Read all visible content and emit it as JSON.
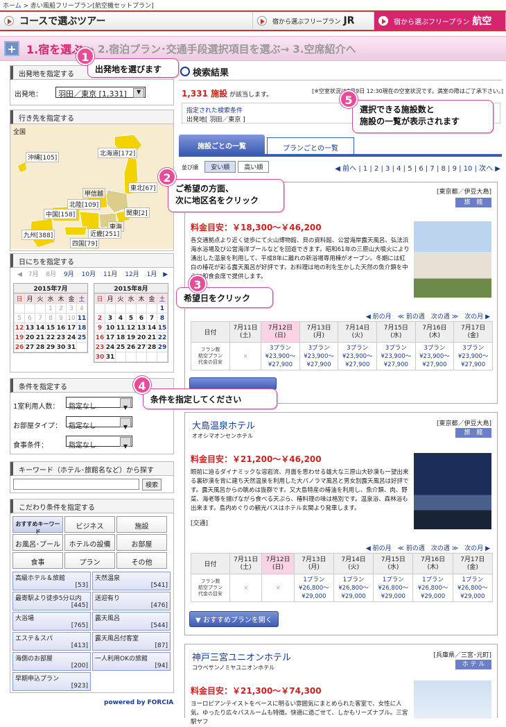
{
  "breadcrumb": {
    "home": "ホーム",
    "sep": ">",
    "current": "赤い風船フリープラン[航空機セットプラン]"
  },
  "nav": {
    "tour": "コースで選ぶツアー",
    "jr_small": "宿から選ぶフリープラン",
    "jr": "JR",
    "air_small": "宿から選ぶフリープラン",
    "air": "航空"
  },
  "steps": {
    "s1": "1.宿を選ぶ",
    "s2": "→ 2.宿泊プラン･交通手段選択項目を選ぶ→ 3.空席紹介へ"
  },
  "departure": {
    "header": "出発地を指定する",
    "label": "出発地：",
    "value": "羽田／東京 [1,331]"
  },
  "destination": {
    "header": "行き先を指定する",
    "all": "全国",
    "regions": [
      "沖縄[105]",
      "北海道[172]",
      "東北[67]",
      "甲信越",
      "北陸[109]",
      "関東[2]",
      "中国[158]",
      "東海",
      "九州[388]",
      "近畿[251]",
      "四国[79]"
    ]
  },
  "calendar": {
    "header": "日にちを指定する",
    "prev": "◀",
    "months": [
      "7月",
      "8月",
      "9月",
      "10月",
      "11月",
      "12月",
      "1月"
    ],
    "next": "▶",
    "m1": {
      "title": "2015年7月",
      "rows": [
        [
          "",
          "",
          "",
          "1",
          "2",
          "3",
          "4"
        ],
        [
          "5",
          "6",
          "7",
          "8",
          "9",
          "10",
          "11"
        ],
        [
          "12",
          "13",
          "14",
          "15",
          "16",
          "17",
          "18"
        ],
        [
          "19",
          "20",
          "21",
          "22",
          "23",
          "24",
          "25"
        ],
        [
          "26",
          "27",
          "28",
          "29",
          "30",
          "31",
          ""
        ]
      ]
    },
    "m2": {
      "title": "2015年8月",
      "rows": [
        [
          "",
          "",
          "",
          "",
          "",
          "",
          "1"
        ],
        [
          "2",
          "3",
          "4",
          "5",
          "6",
          "7",
          "8"
        ],
        [
          "9",
          "10",
          "11",
          "12",
          "13",
          "14",
          "15"
        ],
        [
          "16",
          "17",
          "18",
          "19",
          "20",
          "21",
          "22"
        ],
        [
          "23",
          "24",
          "25",
          "26",
          "27",
          "28",
          "29"
        ],
        [
          "30",
          "31",
          "",
          "",
          "",
          "",
          ""
        ]
      ]
    },
    "weekdays": [
      "日",
      "月",
      "火",
      "水",
      "木",
      "金",
      "土"
    ]
  },
  "conditions": {
    "header": "条件を指定する",
    "fields": [
      {
        "label": "1室利用人数：",
        "value": "指定なし"
      },
      {
        "label": "お部屋タイプ：",
        "value": "指定なし"
      },
      {
        "label": "食事条件：",
        "value": "指定なし"
      }
    ]
  },
  "keyword": {
    "header": "キーワード（ホテル･旅館名など）から探す",
    "button": "検索"
  },
  "kodawari": {
    "header": "こだわり条件を指定する",
    "tabs": [
      "おすすめキーワード",
      "ビジネス",
      "施設",
      "お風呂･プール",
      "ホテルの設備",
      "お部屋",
      "食事",
      "プラン",
      "その他"
    ],
    "items": [
      [
        "高級ホテル＆旅館",
        "[53]"
      ],
      [
        "天然温泉",
        "[541]"
      ],
      [
        "最寄駅より徒歩5分以内",
        "[445]"
      ],
      [
        "送迎有り",
        "[476]"
      ],
      [
        "大浴場",
        "[765]"
      ],
      [
        "露天風呂",
        "[544]"
      ],
      [
        "エステ＆スパ",
        "[413]"
      ],
      [
        "露天風呂付客室",
        "[87]"
      ],
      [
        "海側のお部屋",
        "[200]"
      ],
      [
        "一人利用OKの旅館",
        "[94]"
      ],
      [
        "早期申込プラン",
        "[923]"
      ]
    ]
  },
  "powered": "powered by FORCIA",
  "results": {
    "header": "検索結果",
    "count": "1,331 施設",
    "count_suffix": "が該当します。",
    "note": "[※空室状況は7月9日 12:30現在の空室状況です。満室の際はご了承下さい。]",
    "cond_title": "指定された検索条件",
    "cond_value": "出発地[ 羽田／東京 ]",
    "tab1": "施設ごとの一覧",
    "tab2": "プランごとの一覧",
    "sort_label": "並び順",
    "sort_cheap": "安い順",
    "sort_high": "高い順",
    "pager": "◀ 前へ | 1 | 2 | 3 | 4 | 5 | 6 | 7 | 8 | 9 | 10 | 次へ ▶"
  },
  "hotels": [
    {
      "area": "[東京都／伊豆大島]",
      "type": "旅　館",
      "name": "",
      "kana": "",
      "price": "料金目安：￥18,300～￥46,200",
      "desc": "各交通拠点より近く徒歩にて火山博物館、貝の資料館、公営海岸露天風呂、弘法浜海水浴場及び公営海洋プールなどを回遊できます。昭和61年の三原山大噴火により湧出した温泉を利用して、平成8年に離れの新浴場専用棟がオープン。冬期には紅白の椿花が彩る露天風呂が好評です。お料理は地の利を生かした天然の魚介類を中心に和食会席で提供します。",
      "nav": "◀ 前の月　≪ 前の週　次の週 ≫　次の月 ▶",
      "days": [
        "7月11日\n(土)",
        "7月12日\n(日)",
        "7月13日\n(月)",
        "7月14日\n(火)",
        "7月15日\n(水)",
        "7月16日\n(木)",
        "7月17日\n(金)"
      ],
      "rowlabel": "フラン数\n航空プラン\n代金の目安",
      "cells": [
        "×",
        "3プラン\n¥23,900～\n¥27,900",
        "3プラン\n¥23,900～\n¥27,900",
        "3プラン\n¥23,900～\n¥27,900",
        "3プラン\n¥23,900～\n¥27,900",
        "3プラン\n¥23,900～\n¥27,900",
        "3プラン\n¥23,900～\n¥27,900"
      ],
      "date_label": "日付"
    },
    {
      "area": "[東京都／伊豆大島]",
      "type": "旅　館",
      "name": "大島温泉ホテル",
      "kana": "オオシマオンセンホテル",
      "price": "料金目安：￥21,200～￥46,200",
      "desc": "眼前に迫るダイナミックな溶岩流、月面を思わせる雄大な三原山大砂漠も一望出来る裏砂漠を背に建ち天然温泉を利用した大パノラマ風呂と男女別露天風呂は好評です。露天風呂からの眺めは抜群です。又大島特産の椿油を利用し、魚介類、肉、野菜、海老等を揚げながら食べる天ぷら、椿料理の味は格別です。温泉浴、森林浴も出来ます。島内めぐりの観光バスはホテル玄関より発車します。",
      "access": "[交通]",
      "nav": "◀ 前の月　≪ 前の週　次の週 ≫　次の月 ▶",
      "days": [
        "7月11日\n(土)",
        "7月12日\n(日)",
        "7月13日\n(月)",
        "7月14日\n(火)",
        "7月15日\n(水)",
        "7月16日\n(木)",
        "7月17日\n(金)"
      ],
      "rowlabel": "フラン数\n航空プラン\n代金の目安",
      "cells": [
        "×",
        "×",
        "1プラン\n¥26,800～\n¥29,000",
        "1プラン\n¥26,800～\n¥29,000",
        "1プラン\n¥26,800～\n¥29,000",
        "1プラン\n¥26,800～\n¥29,000",
        "1プラン\n¥26,800～\n¥29,000"
      ],
      "date_label": "日付",
      "button": "おすすめプランを開く"
    },
    {
      "area": "[兵庫県／三宮･元町]",
      "type": "ホ テ ル",
      "name": "神戸三宮ユニオンホテル",
      "kana": "コウベサンノミヤユニオンホテル",
      "price": "料金目安：￥21,300～￥74,300",
      "desc": "ヨーロピアンテイストをベースに明るい雰囲気にまとめられた客室で、女性に人気。ゆったり広々バスルームも特徴。快適に過ごせて、しかもリーズナブル。三宮駅ヤフ"
    }
  ],
  "callouts": [
    {
      "num": "1",
      "text": "出発地を選びます"
    },
    {
      "num": "2",
      "text": "ご希望の方面、\n次に地区名をクリック"
    },
    {
      "num": "3",
      "text": "希望日をクリック"
    },
    {
      "num": "4",
      "text": "条件を指定してください"
    },
    {
      "num": "5",
      "text": "選択できる施設数と\n施設の一覧が表示されます"
    }
  ]
}
